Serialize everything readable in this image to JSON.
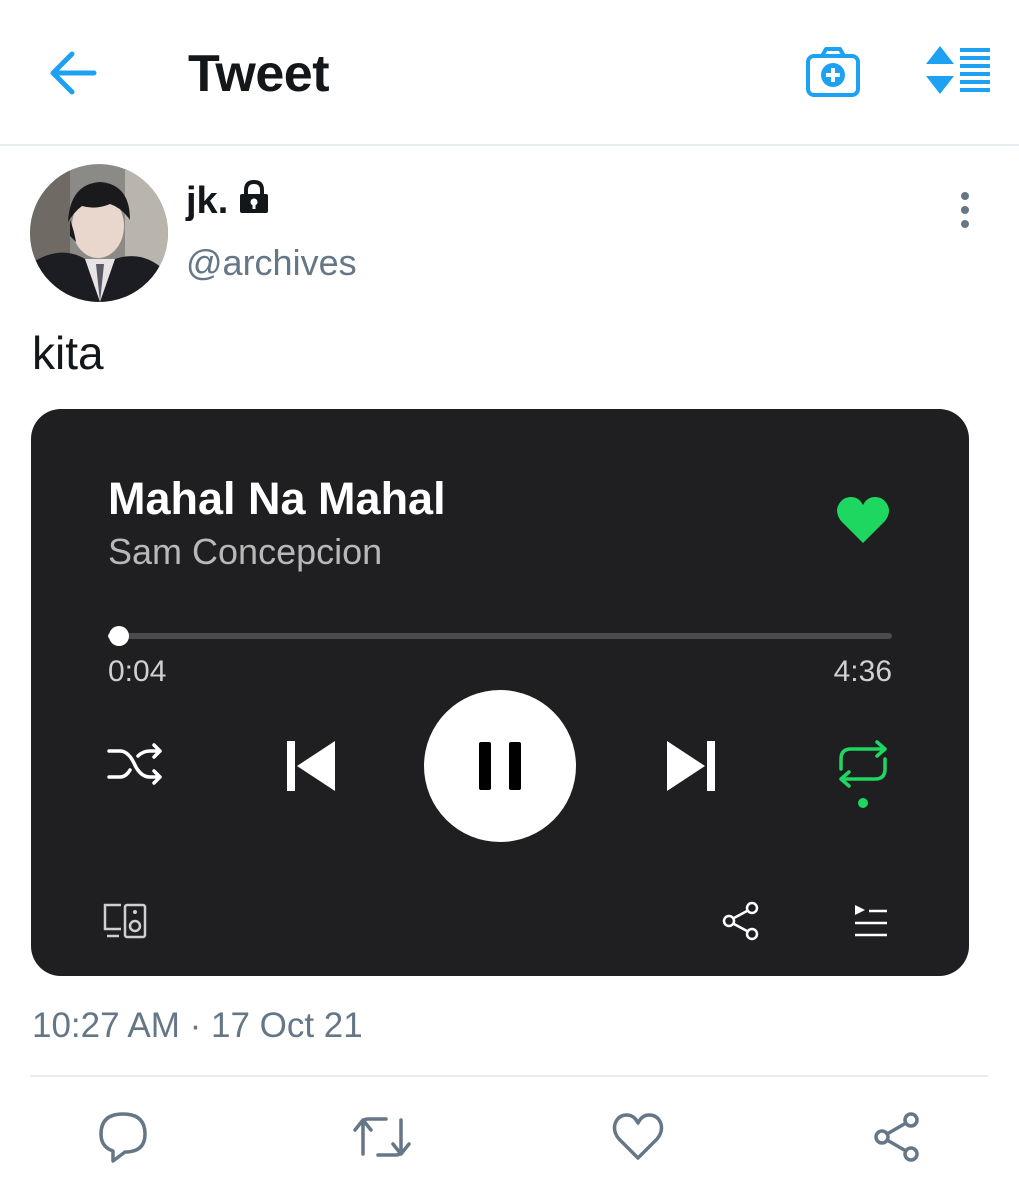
{
  "header": {
    "title": "Tweet",
    "back_icon": "arrow-left-icon",
    "camera_icon": "camera-add-icon",
    "sort_icon": "sort-arrows-icon",
    "accent_color": "#1da1f2"
  },
  "author": {
    "display_name": "jk.",
    "handle": "@archives",
    "protected_icon": "lock-icon"
  },
  "tweet": {
    "text": "kita",
    "timestamp": "10:27 AM · 17 Oct 21"
  },
  "player": {
    "song_title": "Mahal Na Mahal",
    "artist": "Sam Concepcion",
    "elapsed": "0:04",
    "duration": "4:36",
    "progress_fraction": 0.014,
    "liked": true,
    "repeat_on": true,
    "accent_color": "#1ed760",
    "background_color": "#1f1f21"
  },
  "actions": [
    {
      "name": "reply",
      "icon": "comment-icon"
    },
    {
      "name": "retweet",
      "icon": "retweet-icon"
    },
    {
      "name": "like",
      "icon": "heart-outline-icon"
    },
    {
      "name": "share",
      "icon": "share-icon"
    }
  ]
}
